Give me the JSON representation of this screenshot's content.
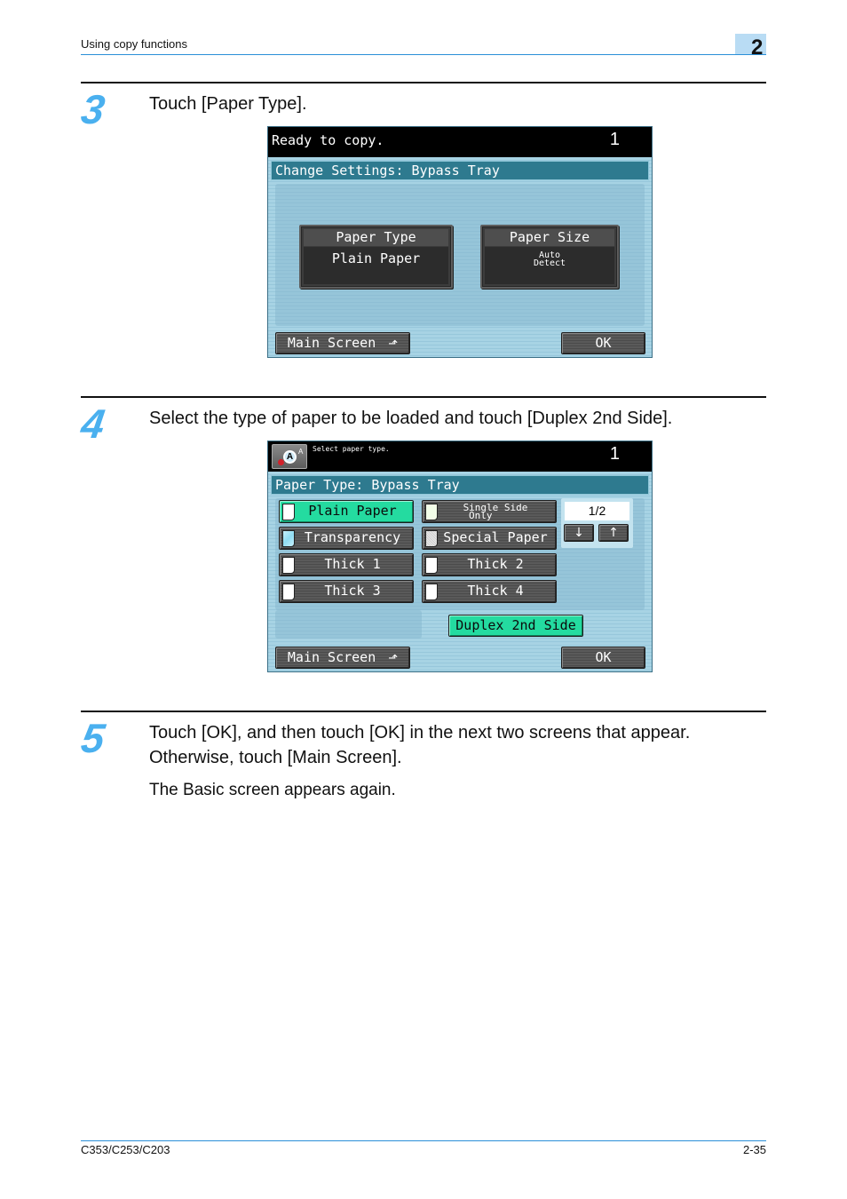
{
  "header": {
    "section_title": "Using copy functions",
    "chapter_number": "2"
  },
  "steps": [
    {
      "number": "3",
      "text": "Touch [Paper Type].",
      "screen": {
        "status_message": "Ready to copy.",
        "copy_count": "1",
        "title": "Change Settings: Bypass Tray",
        "paper_type": {
          "label": "Paper Type",
          "value": "Plain Paper"
        },
        "paper_size": {
          "label": "Paper Size",
          "value_line1": "Auto",
          "value_line2": "Detect"
        },
        "main_screen_label": "Main Screen",
        "ok_label": "OK"
      }
    },
    {
      "number": "4",
      "text": "Select the type of paper to be loaded and touch [Duplex 2nd Side].",
      "screen": {
        "status_message": "Select paper type.",
        "copy_count": "1",
        "title": "Paper Type: Bypass Tray",
        "paper_options": [
          {
            "label": "Plain Paper",
            "selected": true,
            "icon": "plain-paper-icon"
          },
          {
            "label_line1": "Single Side",
            "label_line2": "Only",
            "selected": false,
            "icon": "single-side-paper-icon"
          },
          {
            "label": "Transparency",
            "selected": false,
            "icon": "transparency-icon"
          },
          {
            "label": "Special Paper",
            "selected": false,
            "icon": "special-paper-icon"
          },
          {
            "label": "Thick 1",
            "selected": false,
            "icon": "thick-paper-icon"
          },
          {
            "label": "Thick 2",
            "selected": false,
            "icon": "thick-paper-icon"
          },
          {
            "label": "Thick 3",
            "selected": false,
            "icon": "thick-paper-icon"
          },
          {
            "label": "Thick 4",
            "selected": false,
            "icon": "thick-paper-icon"
          }
        ],
        "page_indicator": "1/2",
        "page_down_glyph": "↓",
        "page_up_glyph": "↑",
        "duplex_label": "Duplex 2nd Side",
        "main_screen_label": "Main Screen",
        "ok_label": "OK"
      }
    },
    {
      "number": "5",
      "text_line1": "Touch [OK], and then touch [OK] in the next two screens that appear.",
      "text_line2": "Otherwise, touch [Main Screen].",
      "result": "The Basic screen appears again."
    }
  ],
  "footer": {
    "model": "C353/C253/C203",
    "page": "2-35"
  },
  "colors": {
    "accent_blue": "#2a8fd8",
    "step_number_blue": "#4ab0ef",
    "selected_green": "#24dba0",
    "panel_title_teal": "#2e7a8f"
  }
}
